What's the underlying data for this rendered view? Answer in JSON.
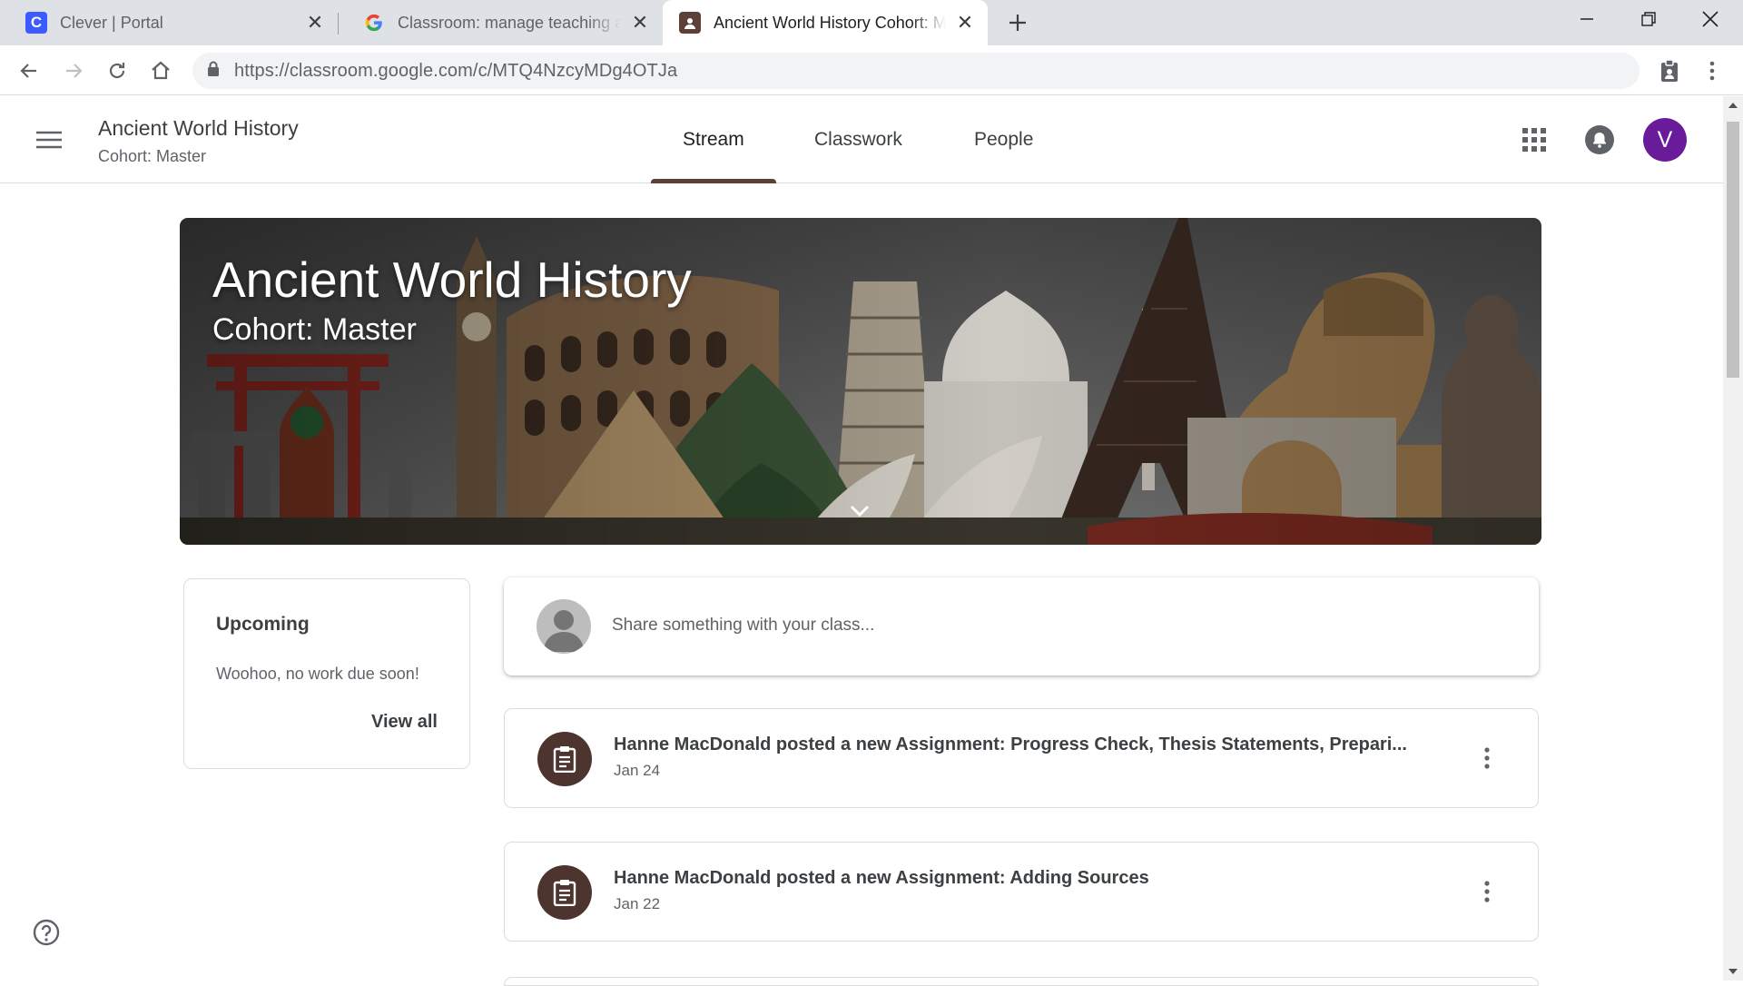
{
  "browser": {
    "tabs": [
      {
        "title": "Clever | Portal",
        "favicon": "C"
      },
      {
        "title": "Classroom: manage teaching and",
        "favicon": "G"
      },
      {
        "title": "Ancient World History Cohort: M",
        "favicon": "classroom"
      }
    ],
    "url_host": "https://classroom.google.com",
    "url_path": "/c/MTQ4NzcyMDg4OTJa"
  },
  "header": {
    "class_title": "Ancient World History",
    "class_section": "Cohort: Master",
    "tabs": [
      "Stream",
      "Classwork",
      "People"
    ],
    "active_tab": "Stream",
    "avatar_initial": "V"
  },
  "banner": {
    "title": "Ancient World History",
    "subtitle": "Cohort: Master"
  },
  "upcoming": {
    "heading": "Upcoming",
    "message": "Woohoo, no work due soon!",
    "view_all": "View all"
  },
  "share": {
    "placeholder": "Share something with your class..."
  },
  "posts": [
    {
      "text": "Hanne MacDonald posted a new Assignment: Progress Check, Thesis Statements, Prepari...",
      "date": "Jan 24"
    },
    {
      "text": "Hanne MacDonald posted a new Assignment: Adding Sources",
      "date": "Jan 22"
    }
  ],
  "colors": {
    "theme": "#5d4037",
    "assignment_icon_bg": "#4e342e",
    "avatar": "#6a1b9a",
    "clever_favicon": "#3d5afe"
  },
  "icons": {
    "assignment": "assignment-icon",
    "more": "more-vert-icon",
    "help": "help-icon"
  }
}
